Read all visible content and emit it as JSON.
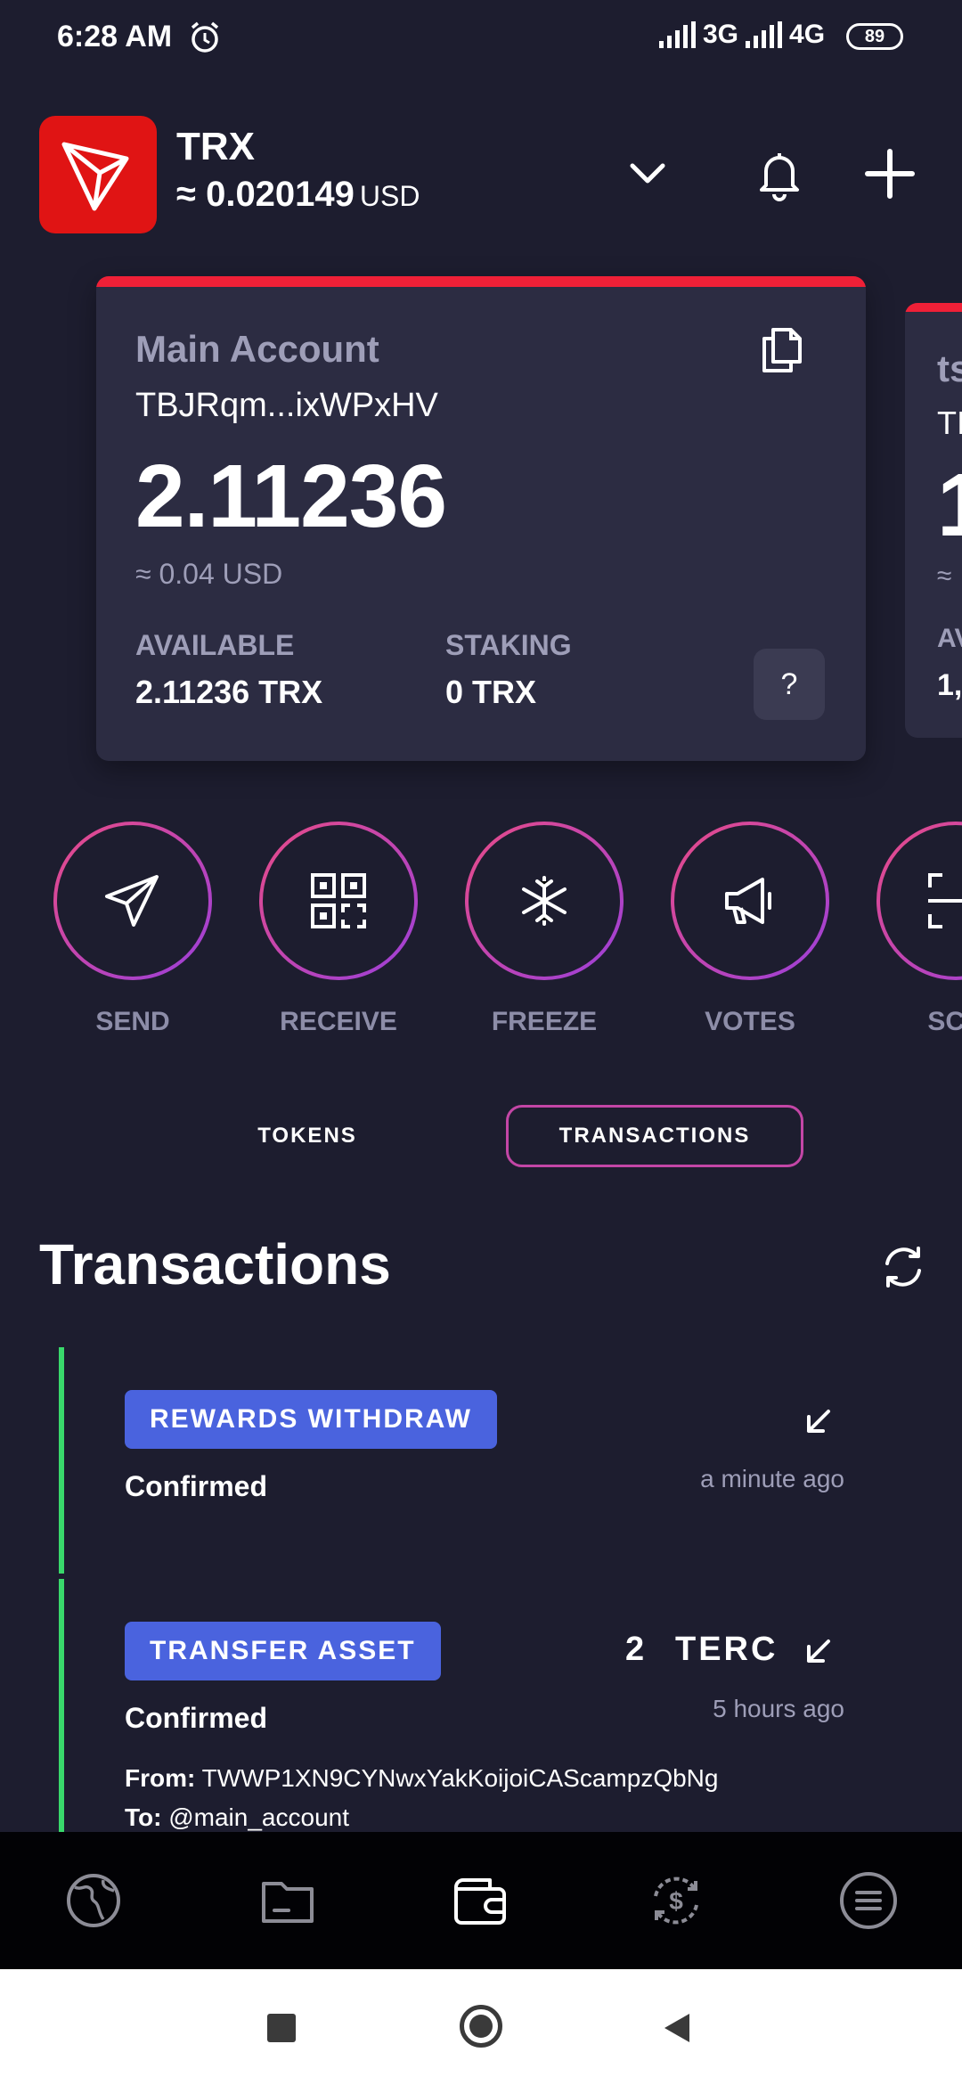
{
  "status_bar": {
    "time": "6:28 AM",
    "network_3g": "3G",
    "network_4g": "4G",
    "battery": "89"
  },
  "header": {
    "token": "TRX",
    "price_prefix": "≈",
    "price_value": "0.020149",
    "price_unit": "USD"
  },
  "account_card": {
    "name": "Main Account",
    "address": "TBJRqm...ixWPxHV",
    "balance": "2.11236",
    "fiat": "≈ 0.04 USD",
    "available_label": "AVAILABLE",
    "available_value": "2.11236 TRX",
    "staking_label": "STAKING",
    "staking_value": "0 TRX",
    "help": "?"
  },
  "peek_card": {
    "name": "ts",
    "address": "TI",
    "balance": "1",
    "fiat": "≈",
    "label": "AV",
    "value": "1,"
  },
  "actions": [
    {
      "label": "SEND",
      "icon": "paper-plane-icon"
    },
    {
      "label": "RECEIVE",
      "icon": "qr-code-icon"
    },
    {
      "label": "FREEZE",
      "icon": "snowflake-icon"
    },
    {
      "label": "VOTES",
      "icon": "megaphone-icon"
    },
    {
      "label": "SCA",
      "icon": "scan-icon"
    }
  ],
  "tabs": {
    "tokens": "TOKENS",
    "transactions": "TRANSACTIONS",
    "active": "transactions"
  },
  "section_title": "Transactions",
  "transactions": [
    {
      "type": "REWARDS WITHDRAW",
      "status": "Confirmed",
      "time": "a minute ago"
    },
    {
      "type": "TRANSFER ASSET",
      "status": "Confirmed",
      "time": "5 hours ago",
      "amount": "2",
      "token": "TERC",
      "from_label": "From:",
      "from": "TWWP1XN9CYNwxYakKoijoiCAScampzQbNg",
      "to_label": "To:",
      "to": "@main_account"
    }
  ],
  "bottom_nav": [
    "globe-icon",
    "folder-icon",
    "wallet-icon",
    "exchange-icon",
    "menu-icon"
  ],
  "colors": {
    "background": "#1d1d2f",
    "card": "#2c2c42",
    "accent_red": "#ef2037",
    "badge": "#4a63de",
    "confirmed": "#39d86b"
  }
}
